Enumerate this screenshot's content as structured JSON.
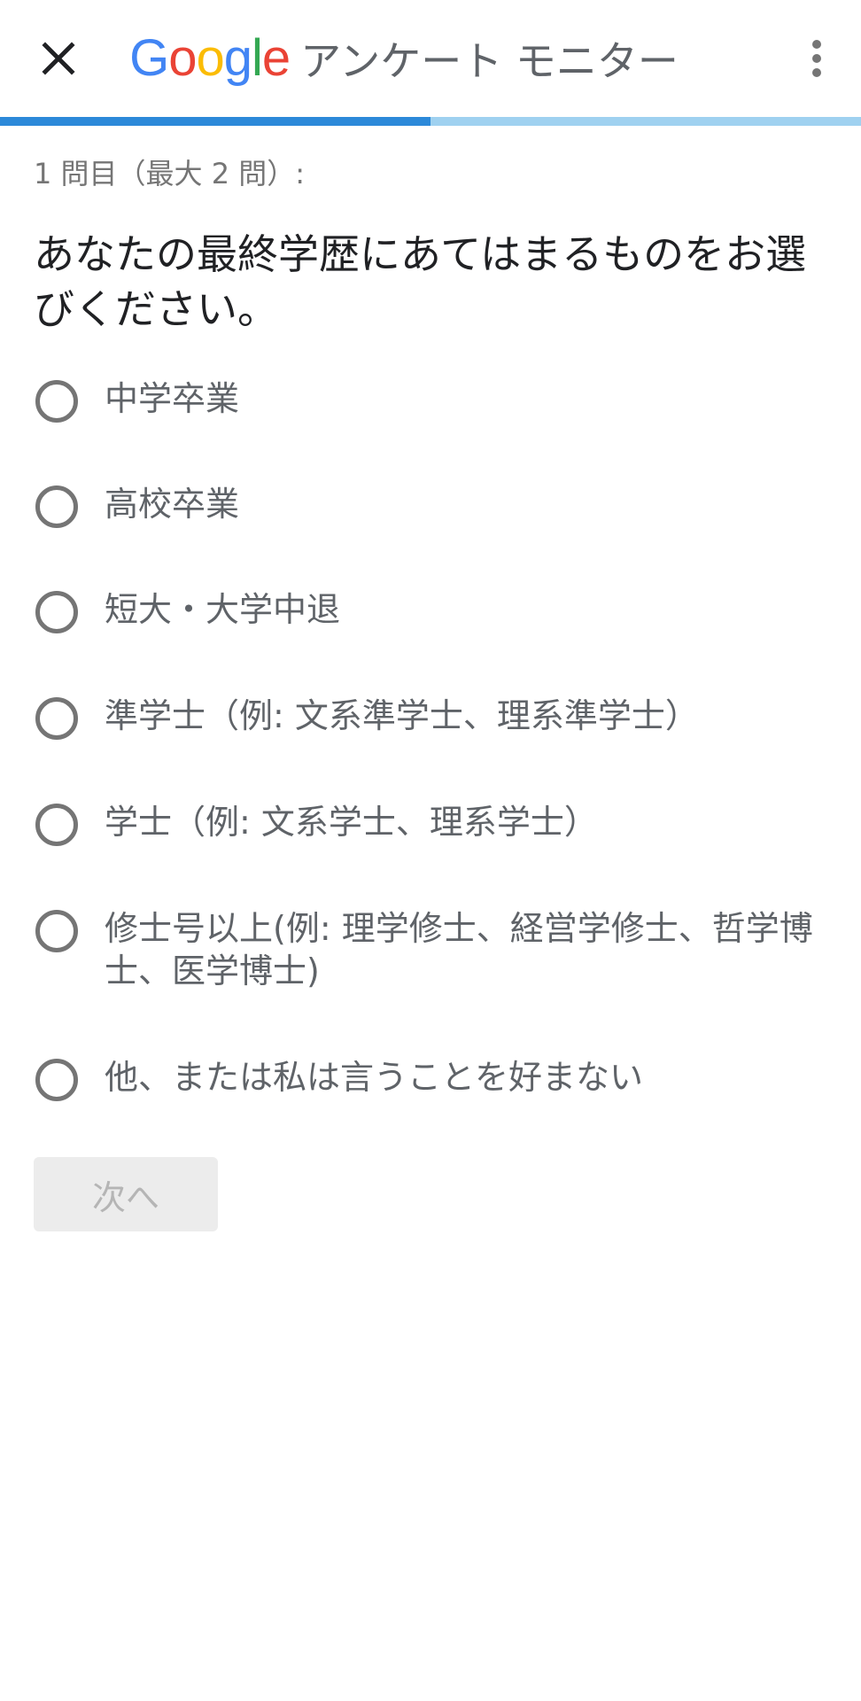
{
  "app_bar": {
    "logo_letters": [
      {
        "char": "G",
        "color": "#4285F4"
      },
      {
        "char": "o",
        "color": "#EA4335"
      },
      {
        "char": "o",
        "color": "#FBBC05"
      },
      {
        "char": "g",
        "color": "#4285F4"
      },
      {
        "char": "l",
        "color": "#34A853"
      },
      {
        "char": "e",
        "color": "#EA4335"
      }
    ],
    "title": "アンケート モニター",
    "close_icon": "close-icon",
    "menu_icon": "more-vert-icon"
  },
  "progress": {
    "fraction": 0.5,
    "fill_color": "#2c89d9",
    "track_color": "#9fd1f0"
  },
  "survey": {
    "counter": "1 問目（最大 2 問）:",
    "question": "あなたの最終学歴にあてはまるものをお選びください。",
    "options": [
      "中学卒業",
      "高校卒業",
      "短大・大学中退",
      "準学士（例: 文系準学士、理系準学士）",
      "学士（例: 文系学士、理系学士）",
      "修士号以上(例: 理学修士、経営学修士、哲学博士、医学博士)",
      "他、または私は言うことを好まない"
    ],
    "next_label": "次へ"
  }
}
